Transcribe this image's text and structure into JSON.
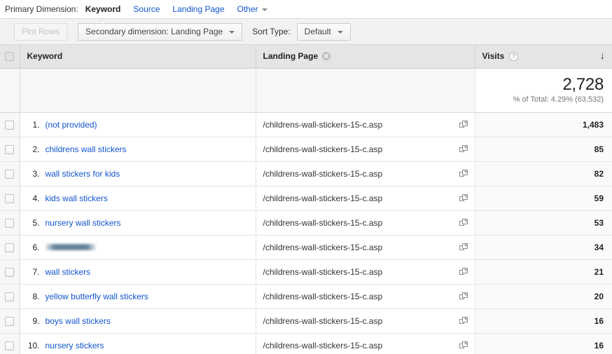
{
  "primary_dimension": {
    "label": "Primary Dimension:",
    "tabs": [
      {
        "label": "Keyword",
        "active": true
      },
      {
        "label": "Source",
        "active": false
      },
      {
        "label": "Landing Page",
        "active": false
      },
      {
        "label": "Other",
        "active": false,
        "has_caret": true
      }
    ]
  },
  "toolbar": {
    "plot_rows_label": "Plot Rows",
    "secondary_dimension_label": "Secondary dimension: Landing Page",
    "sort_type_label": "Sort Type:",
    "sort_type_value": "Default"
  },
  "table": {
    "columns": {
      "keyword": "Keyword",
      "landing_page": "Landing Page",
      "visits": "Visits",
      "help_glyph": "?",
      "sort_glyph": "↓"
    },
    "summary": {
      "total": "2,728",
      "subtext": "% of Total: 4.29% (63,532)"
    },
    "rows": [
      {
        "index": "1.",
        "keyword": "(not provided)",
        "redacted": false,
        "landing_page": "/childrens-wall-stickers-15-c.asp",
        "visits": "1,483"
      },
      {
        "index": "2.",
        "keyword": "childrens wall stickers",
        "redacted": false,
        "landing_page": "/childrens-wall-stickers-15-c.asp",
        "visits": "85"
      },
      {
        "index": "3.",
        "keyword": "wall stickers for kids",
        "redacted": false,
        "landing_page": "/childrens-wall-stickers-15-c.asp",
        "visits": "82"
      },
      {
        "index": "4.",
        "keyword": "kids wall stickers",
        "redacted": false,
        "landing_page": "/childrens-wall-stickers-15-c.asp",
        "visits": "59"
      },
      {
        "index": "5.",
        "keyword": "nursery wall stickers",
        "redacted": false,
        "landing_page": "/childrens-wall-stickers-15-c.asp",
        "visits": "53"
      },
      {
        "index": "6.",
        "keyword": "",
        "redacted": true,
        "landing_page": "/childrens-wall-stickers-15-c.asp",
        "visits": "34"
      },
      {
        "index": "7.",
        "keyword": "wall stickers",
        "redacted": false,
        "landing_page": "/childrens-wall-stickers-15-c.asp",
        "visits": "21"
      },
      {
        "index": "8.",
        "keyword": "yellow butterfly wall stickers",
        "redacted": false,
        "landing_page": "/childrens-wall-stickers-15-c.asp",
        "visits": "20"
      },
      {
        "index": "9.",
        "keyword": "boys wall stickers",
        "redacted": false,
        "landing_page": "/childrens-wall-stickers-15-c.asp",
        "visits": "16"
      },
      {
        "index": "10.",
        "keyword": "nursery stickers",
        "redacted": false,
        "landing_page": "/childrens-wall-stickers-15-c.asp",
        "visits": "16"
      }
    ]
  },
  "colors": {
    "link": "#1155cc",
    "header_bg": "#e5e5e5",
    "summary_bg": "#f7f7f7",
    "toolbar_bg": "#f2f2f2"
  }
}
